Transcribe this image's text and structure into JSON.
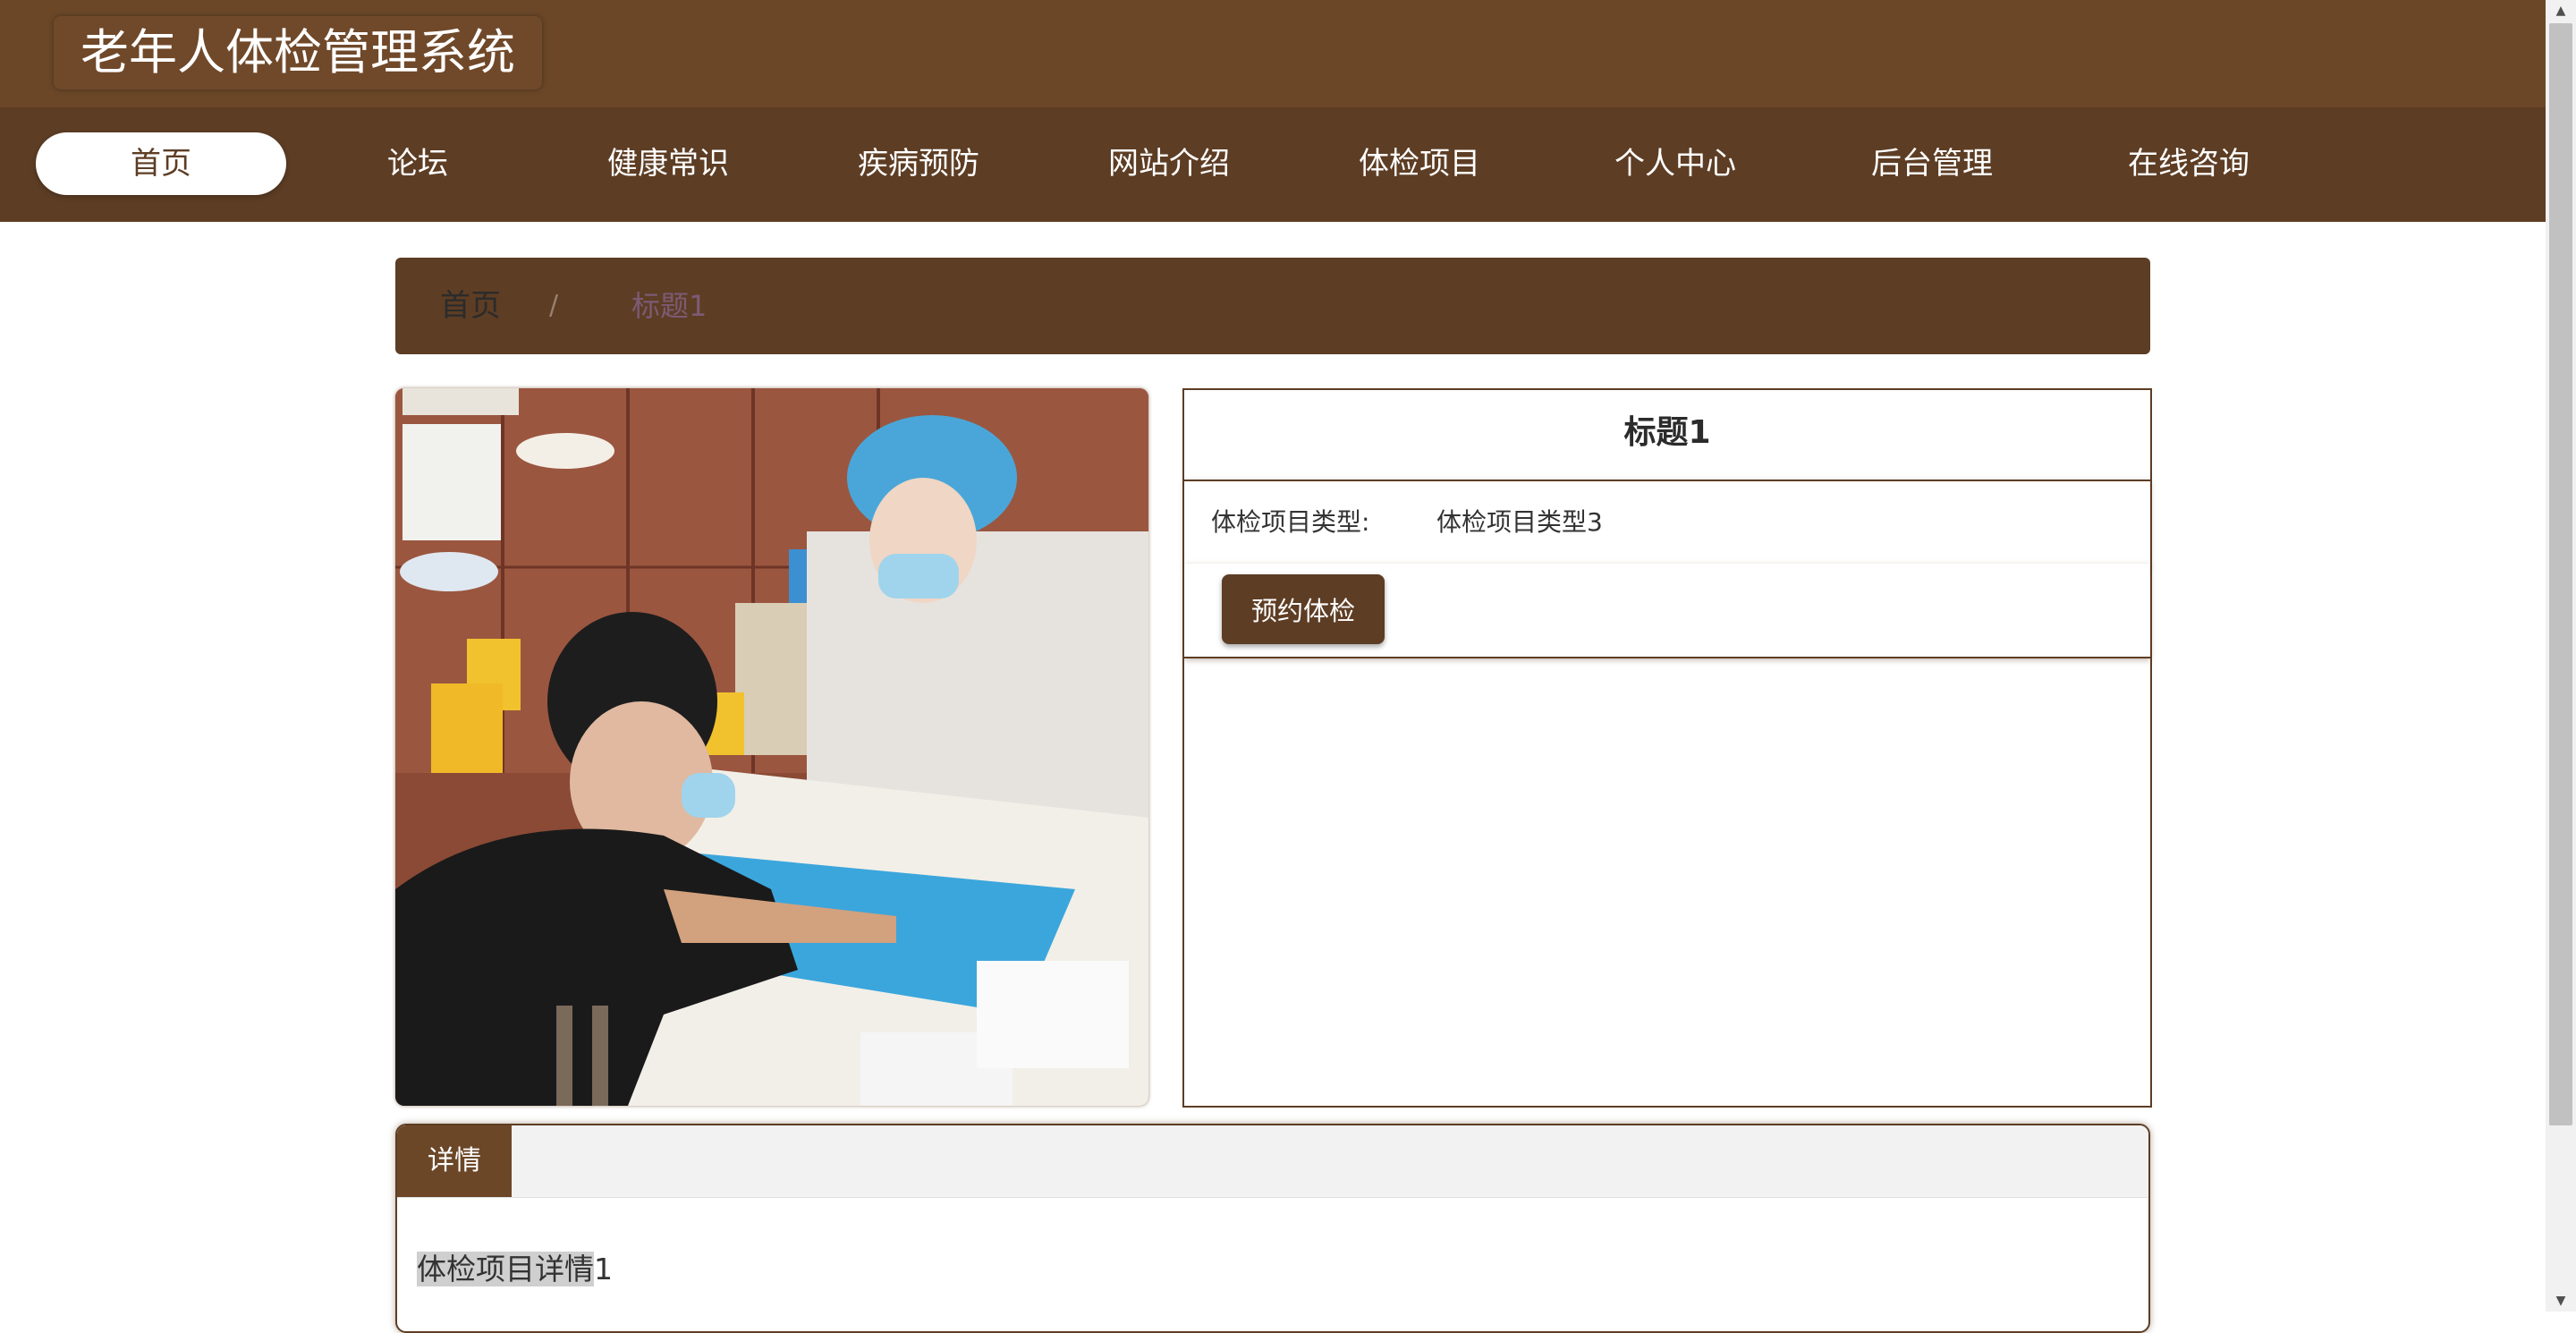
{
  "header": {
    "site_title": "老年人体检管理系统"
  },
  "nav": {
    "items": [
      {
        "label": "首页",
        "active": true
      },
      {
        "label": "论坛"
      },
      {
        "label": "健康常识"
      },
      {
        "label": "疾病预防"
      },
      {
        "label": "网站介绍"
      },
      {
        "label": "体检项目"
      },
      {
        "label": "个人中心"
      },
      {
        "label": "后台管理"
      },
      {
        "label": "在线咨询"
      }
    ]
  },
  "breadcrumb": {
    "home": "首页",
    "separator": "/",
    "current": "标题1"
  },
  "item": {
    "title": "标题1",
    "type_label": "体检项目类型:",
    "type_value": "体检项目类型3",
    "book_button": "预约体检",
    "photo_icon": "medical-checkup-photo"
  },
  "detail": {
    "tab_label": "详情",
    "text_highlight": "体检项目详情",
    "text_rest": "1"
  },
  "colors": {
    "header_bg": "#6b4728",
    "nav_bg": "#5d3d24",
    "accent": "#5d3d24",
    "breadcrumb_current": "#7d5a74"
  }
}
